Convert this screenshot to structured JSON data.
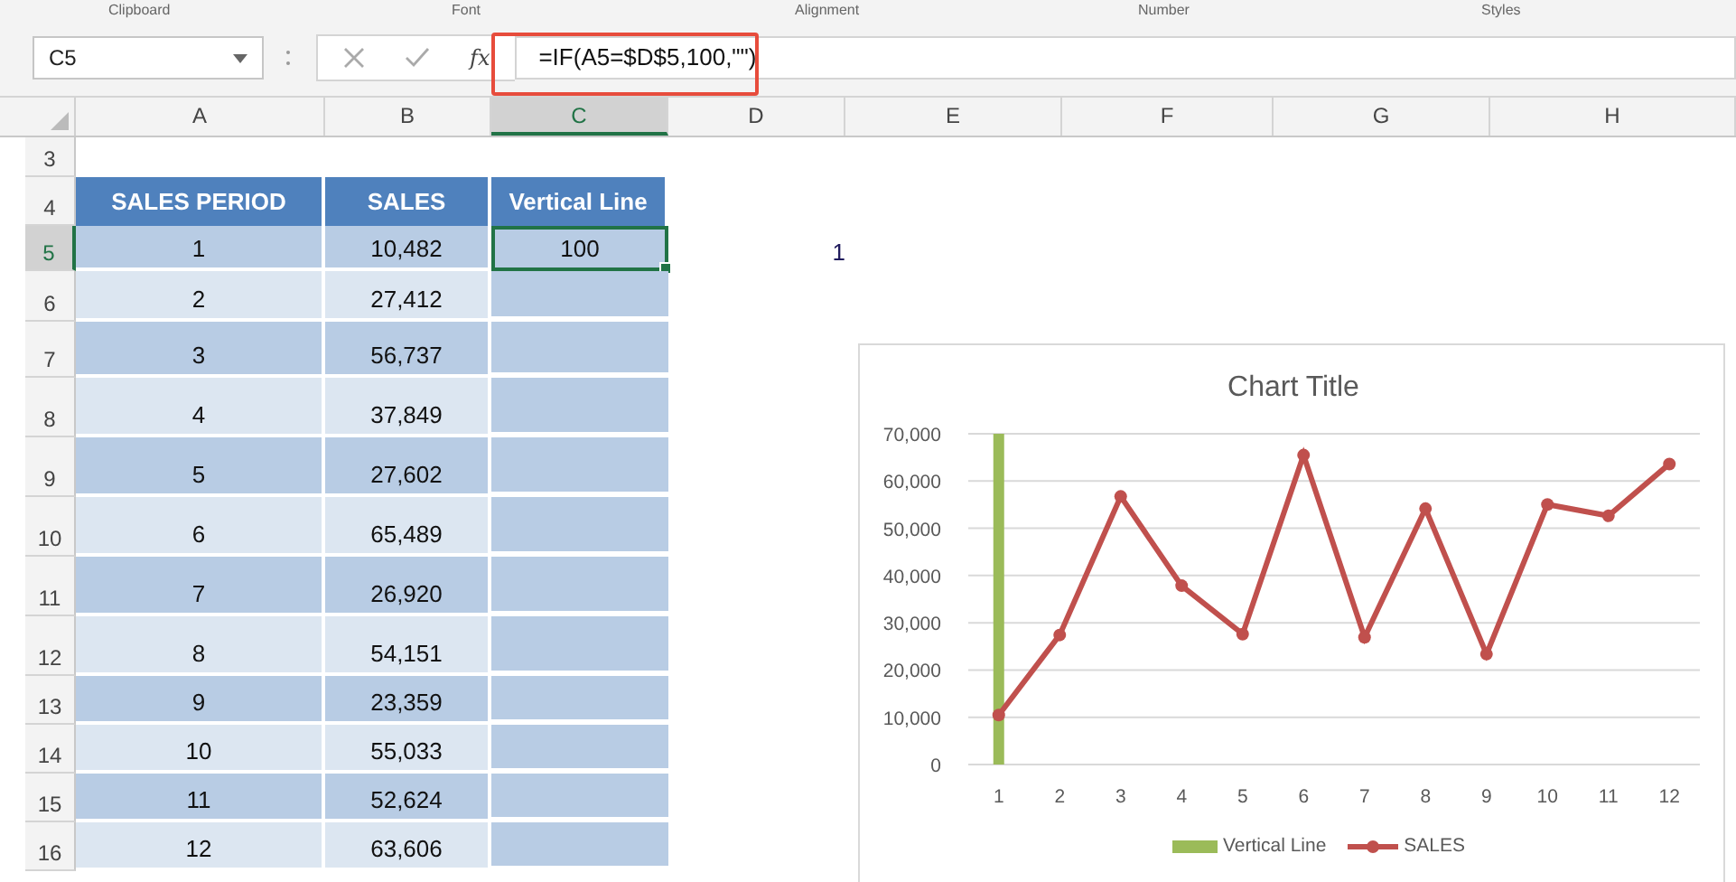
{
  "ribbon_groups": [
    "Clipboard",
    "Font",
    "Alignment",
    "Number",
    "Styles"
  ],
  "formula_bar": {
    "name_box": "C5",
    "formula": "=IF(A5=$D$5,100,\"\")",
    "function_label": "fx"
  },
  "columns": [
    {
      "label": "A",
      "selected": false
    },
    {
      "label": "B",
      "selected": false
    },
    {
      "label": "C",
      "selected": true
    },
    {
      "label": "D",
      "selected": false
    },
    {
      "label": "E",
      "selected": false
    },
    {
      "label": "F",
      "selected": false
    },
    {
      "label": "G",
      "selected": false
    },
    {
      "label": "H",
      "selected": false
    }
  ],
  "rows": [
    {
      "number": "3",
      "selected": false,
      "kind": "blank",
      "cells": []
    },
    {
      "number": "4",
      "selected": false,
      "kind": "header",
      "cells": [
        "SALES PERIOD",
        "SALES",
        "Vertical Line"
      ]
    },
    {
      "number": "5",
      "selected": true,
      "kind": "data",
      "cells": [
        "1",
        "10,482",
        "100",
        "1"
      ]
    },
    {
      "number": "6",
      "selected": false,
      "kind": "data",
      "cells": [
        "2",
        "27,412",
        ""
      ]
    },
    {
      "number": "7",
      "selected": false,
      "kind": "data",
      "cells": [
        "3",
        "56,737",
        ""
      ]
    },
    {
      "number": "8",
      "selected": false,
      "kind": "data",
      "cells": [
        "4",
        "37,849",
        ""
      ]
    },
    {
      "number": "9",
      "selected": false,
      "kind": "data",
      "cells": [
        "5",
        "27,602",
        ""
      ]
    },
    {
      "number": "10",
      "selected": false,
      "kind": "data",
      "cells": [
        "6",
        "65,489",
        ""
      ]
    },
    {
      "number": "11",
      "selected": false,
      "kind": "data",
      "cells": [
        "7",
        "26,920",
        ""
      ]
    },
    {
      "number": "12",
      "selected": false,
      "kind": "data",
      "cells": [
        "8",
        "54,151",
        ""
      ]
    },
    {
      "number": "13",
      "selected": false,
      "kind": "data",
      "cells": [
        "9",
        "23,359",
        ""
      ]
    },
    {
      "number": "14",
      "selected": false,
      "kind": "data",
      "cells": [
        "10",
        "55,033",
        ""
      ]
    },
    {
      "number": "15",
      "selected": false,
      "kind": "data",
      "cells": [
        "11",
        "52,624",
        ""
      ]
    },
    {
      "number": "16",
      "selected": false,
      "kind": "data",
      "cells": [
        "12",
        "63,606",
        ""
      ]
    }
  ],
  "chart": {
    "chart_data": {
      "type": "line",
      "title": "Chart Title",
      "x": [
        1,
        2,
        3,
        4,
        5,
        6,
        7,
        8,
        9,
        10,
        11,
        12
      ],
      "xticks": [
        1,
        2,
        3,
        4,
        5,
        6,
        7,
        8,
        9,
        10,
        11,
        12
      ],
      "xlim": [
        0.5,
        12.5
      ],
      "series": [
        {
          "name": "Vertical Line",
          "type": "bar",
          "color": "#9bbb59",
          "values": [
            70000,
            null,
            null,
            null,
            null,
            null,
            null,
            null,
            null,
            null,
            null,
            null
          ]
        },
        {
          "name": "SALES",
          "type": "line",
          "marker": true,
          "color": "#c0504d",
          "values": [
            10482,
            27412,
            56737,
            37849,
            27602,
            65489,
            26920,
            54151,
            23359,
            55033,
            52624,
            63606
          ]
        }
      ],
      "ylim": [
        0,
        70000
      ],
      "grid": true,
      "legend": true,
      "yticks": [
        {
          "value": 0,
          "label": "0"
        },
        {
          "value": 10000,
          "label": "10,000"
        },
        {
          "value": 20000,
          "label": "20,000"
        },
        {
          "value": 30000,
          "label": "30,000"
        },
        {
          "value": 40000,
          "label": "40,000"
        },
        {
          "value": 50000,
          "label": "50,000"
        },
        {
          "value": 60000,
          "label": "60,000"
        },
        {
          "value": 70000,
          "label": "70,000"
        }
      ]
    }
  }
}
